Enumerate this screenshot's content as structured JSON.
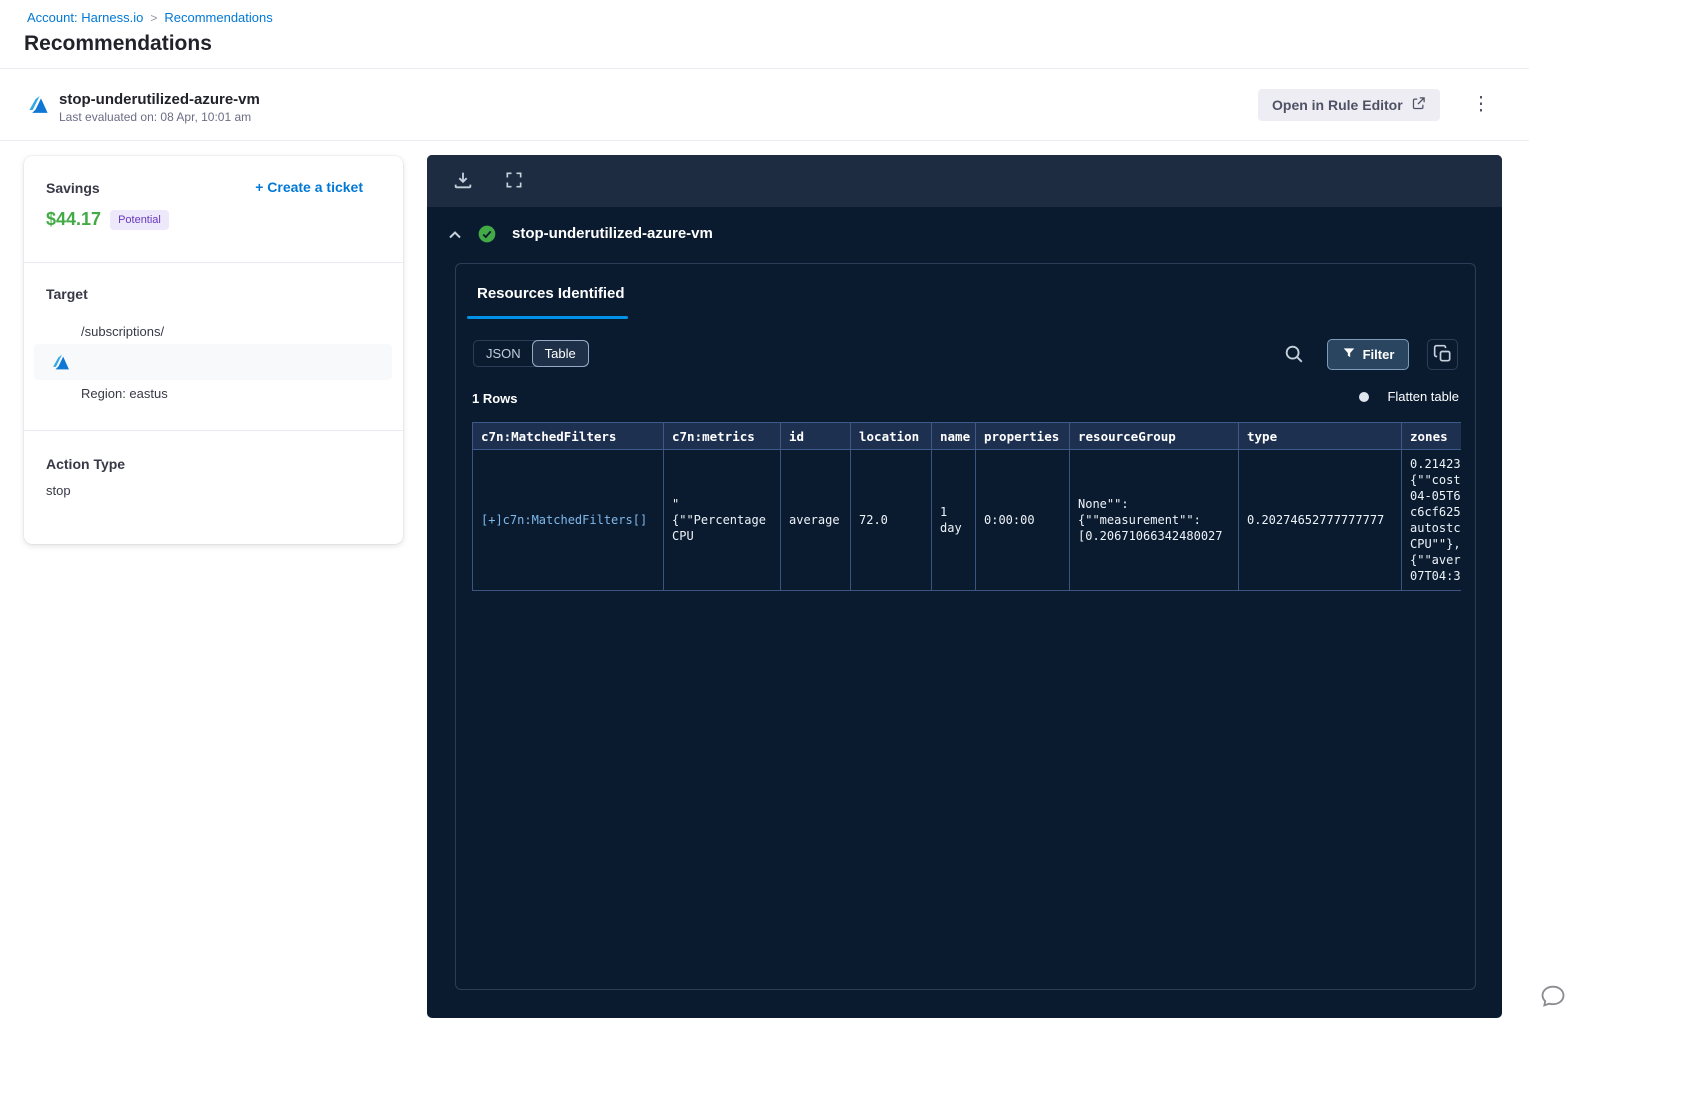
{
  "breadcrumb": {
    "account_link": "Account: Harness.io",
    "separator": ">",
    "current": "Recommendations"
  },
  "page_title": "Recommendations",
  "rule_header": {
    "title": "stop-underutilized-azure-vm",
    "subtitle": "Last evaluated on: 08 Apr, 10:01 am",
    "open_rule_editor_label": "Open in Rule Editor",
    "kebab_menu": "⋮"
  },
  "savings_card": {
    "savings_label": "Savings",
    "amount": "$44.17",
    "badge": "Potential",
    "create_ticket_label": "+ Create a ticket",
    "target_label": "Target",
    "target_path": "/subscriptions/",
    "region": "Region: eastus",
    "action_type_label": "Action Type",
    "action_type_value": "stop"
  },
  "panel": {
    "title": "stop-underutilized-azure-vm",
    "tab_label": "Resources Identified",
    "view_toggle": {
      "json": "JSON",
      "table": "Table",
      "active": "Table"
    },
    "filter_label": "Filter",
    "rows_count": "1 Rows",
    "flatten_label": "Flatten table",
    "table": {
      "headers": [
        "c7n:MatchedFilters",
        "c7n:metrics",
        "id",
        "location",
        "name",
        "properties",
        "resourceGroup",
        "type",
        "zones"
      ],
      "cells": [
        "[+]c7n:MatchedFilters[]",
        "\"\n{\"\"Percentage\nCPU",
        "average",
        "72.0",
        "1\nday",
        "0:00:00",
        "None\"\":\n{\"\"measurement\"\":\n[0.20671066342480027",
        "0.20274652777777777",
        "0.21423\n{\"\"cost\n04-05T6\nc6cf625\nautostc\nCPU\"\"},\n{\"\"aver\n07T04:3"
      ]
    }
  },
  "icons": {
    "azure_logo": "azure-logo-icon",
    "download": "download-icon",
    "expand": "expand-icon",
    "collapse_chevron": "chevron-up-icon",
    "success_check": "check-circle-icon",
    "search": "search-icon",
    "filter": "funnel-icon",
    "copy": "copy-icon",
    "external_link": "external-link-icon",
    "help": "chat-bubble-icon"
  },
  "colors": {
    "accent_blue": "#0278d5",
    "savings_green": "#42ab45",
    "badge_purple_bg": "#ede8fa",
    "badge_purple_text": "#6938c0",
    "panel_dark": "#0a1b30",
    "panel_toolbar": "#1d2c41",
    "table_header_bg": "#1e3050",
    "table_border": "#41598a",
    "tab_underline": "#0092e4",
    "success_green": "#42ab45"
  }
}
